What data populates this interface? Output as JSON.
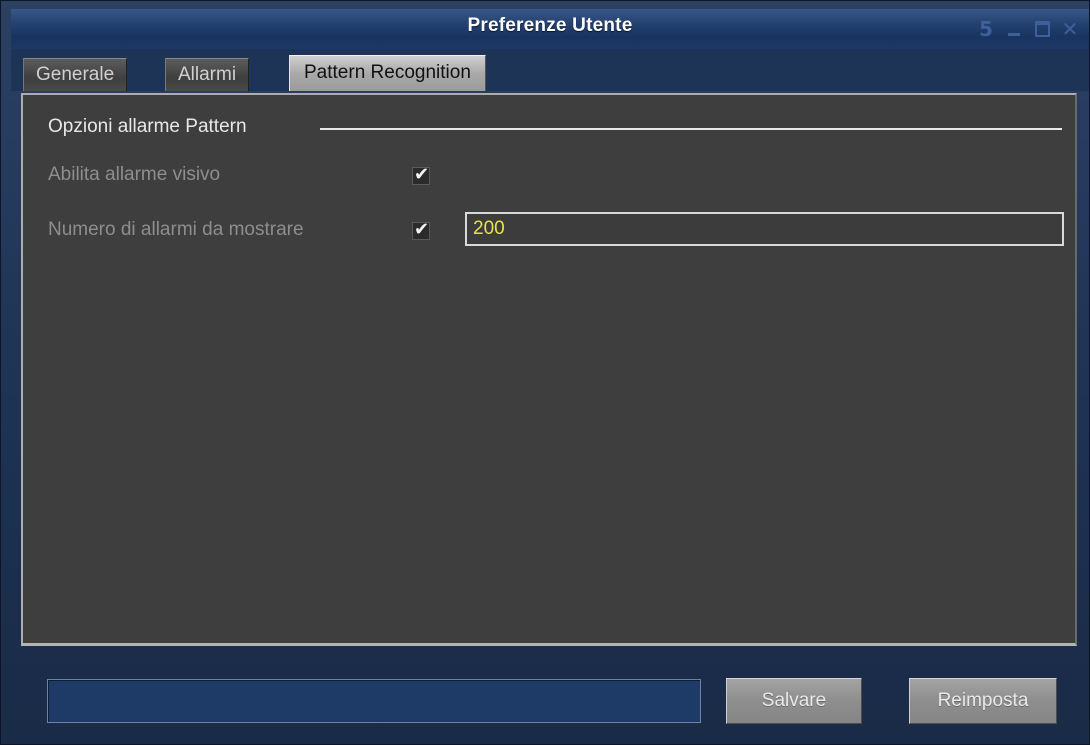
{
  "window": {
    "title": "Preferenze Utente",
    "controls": {
      "restore_glyph": "5",
      "close_glyph": "✕"
    }
  },
  "tabs": [
    {
      "label": "Generale",
      "active": false
    },
    {
      "label": "Allarmi",
      "active": false
    },
    {
      "label": "Pattern Recognition",
      "active": true
    }
  ],
  "pattern": {
    "group_title": "Opzioni allarme Pattern",
    "visual_alarm_label": "Abilita allarme visivo",
    "visual_alarm_checked": true,
    "alarm_count_label": "Numero di allarmi da mostrare",
    "alarm_count_checked": true,
    "alarm_count_value": "200"
  },
  "footer": {
    "status_text": "",
    "save_label": "Salvare",
    "reset_label": "Reimposta"
  },
  "colors": {
    "titlebar": "#1d3865",
    "panel": "#3e3e3e",
    "input_text": "#e6e34a",
    "checkmark": "#f4f4f4"
  }
}
